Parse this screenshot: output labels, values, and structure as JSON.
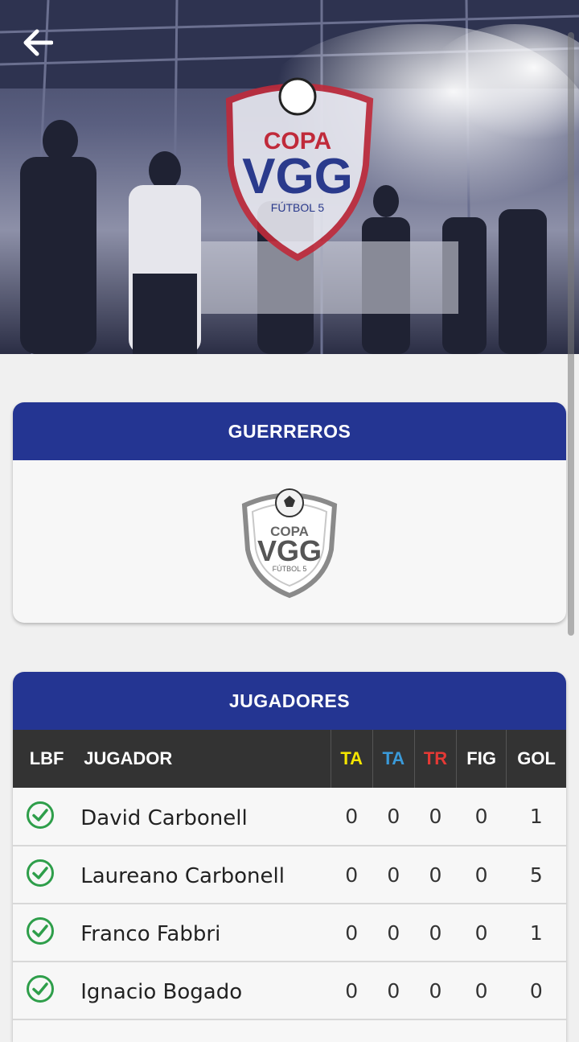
{
  "header": {
    "back_icon": "arrow-left-icon"
  },
  "hero": {
    "logo_top": "COPA",
    "logo_main": "VGG",
    "logo_sub": "FÚTBOL 5"
  },
  "team": {
    "title": "GUERREROS",
    "logo_top": "COPA",
    "logo_main": "VGG",
    "logo_sub": "FÚTBOL 5"
  },
  "players": {
    "title": "JUGADORES",
    "columns": {
      "lbf": "LBF",
      "jugador": "JUGADOR",
      "ta_yellow": "TA",
      "ta_blue": "TA",
      "tr": "TR",
      "fig": "FIG",
      "gol": "GOL"
    },
    "column_colors": {
      "ta_yellow": "#f5e600",
      "ta_blue": "#3a9ad9",
      "tr": "#e53935"
    },
    "check_color": "#2e9e4a",
    "rows": [
      {
        "name": "David Carbonell",
        "ta_yellow": "0",
        "ta_blue": "0",
        "tr": "0",
        "fig": "0",
        "gol": "1"
      },
      {
        "name": "Laureano Carbonell",
        "ta_yellow": "0",
        "ta_blue": "0",
        "tr": "0",
        "fig": "0",
        "gol": "5"
      },
      {
        "name": "Franco Fabbri",
        "ta_yellow": "0",
        "ta_blue": "0",
        "tr": "0",
        "fig": "0",
        "gol": "1"
      },
      {
        "name": "Ignacio Bogado",
        "ta_yellow": "0",
        "ta_blue": "0",
        "tr": "0",
        "fig": "0",
        "gol": "0"
      }
    ]
  }
}
